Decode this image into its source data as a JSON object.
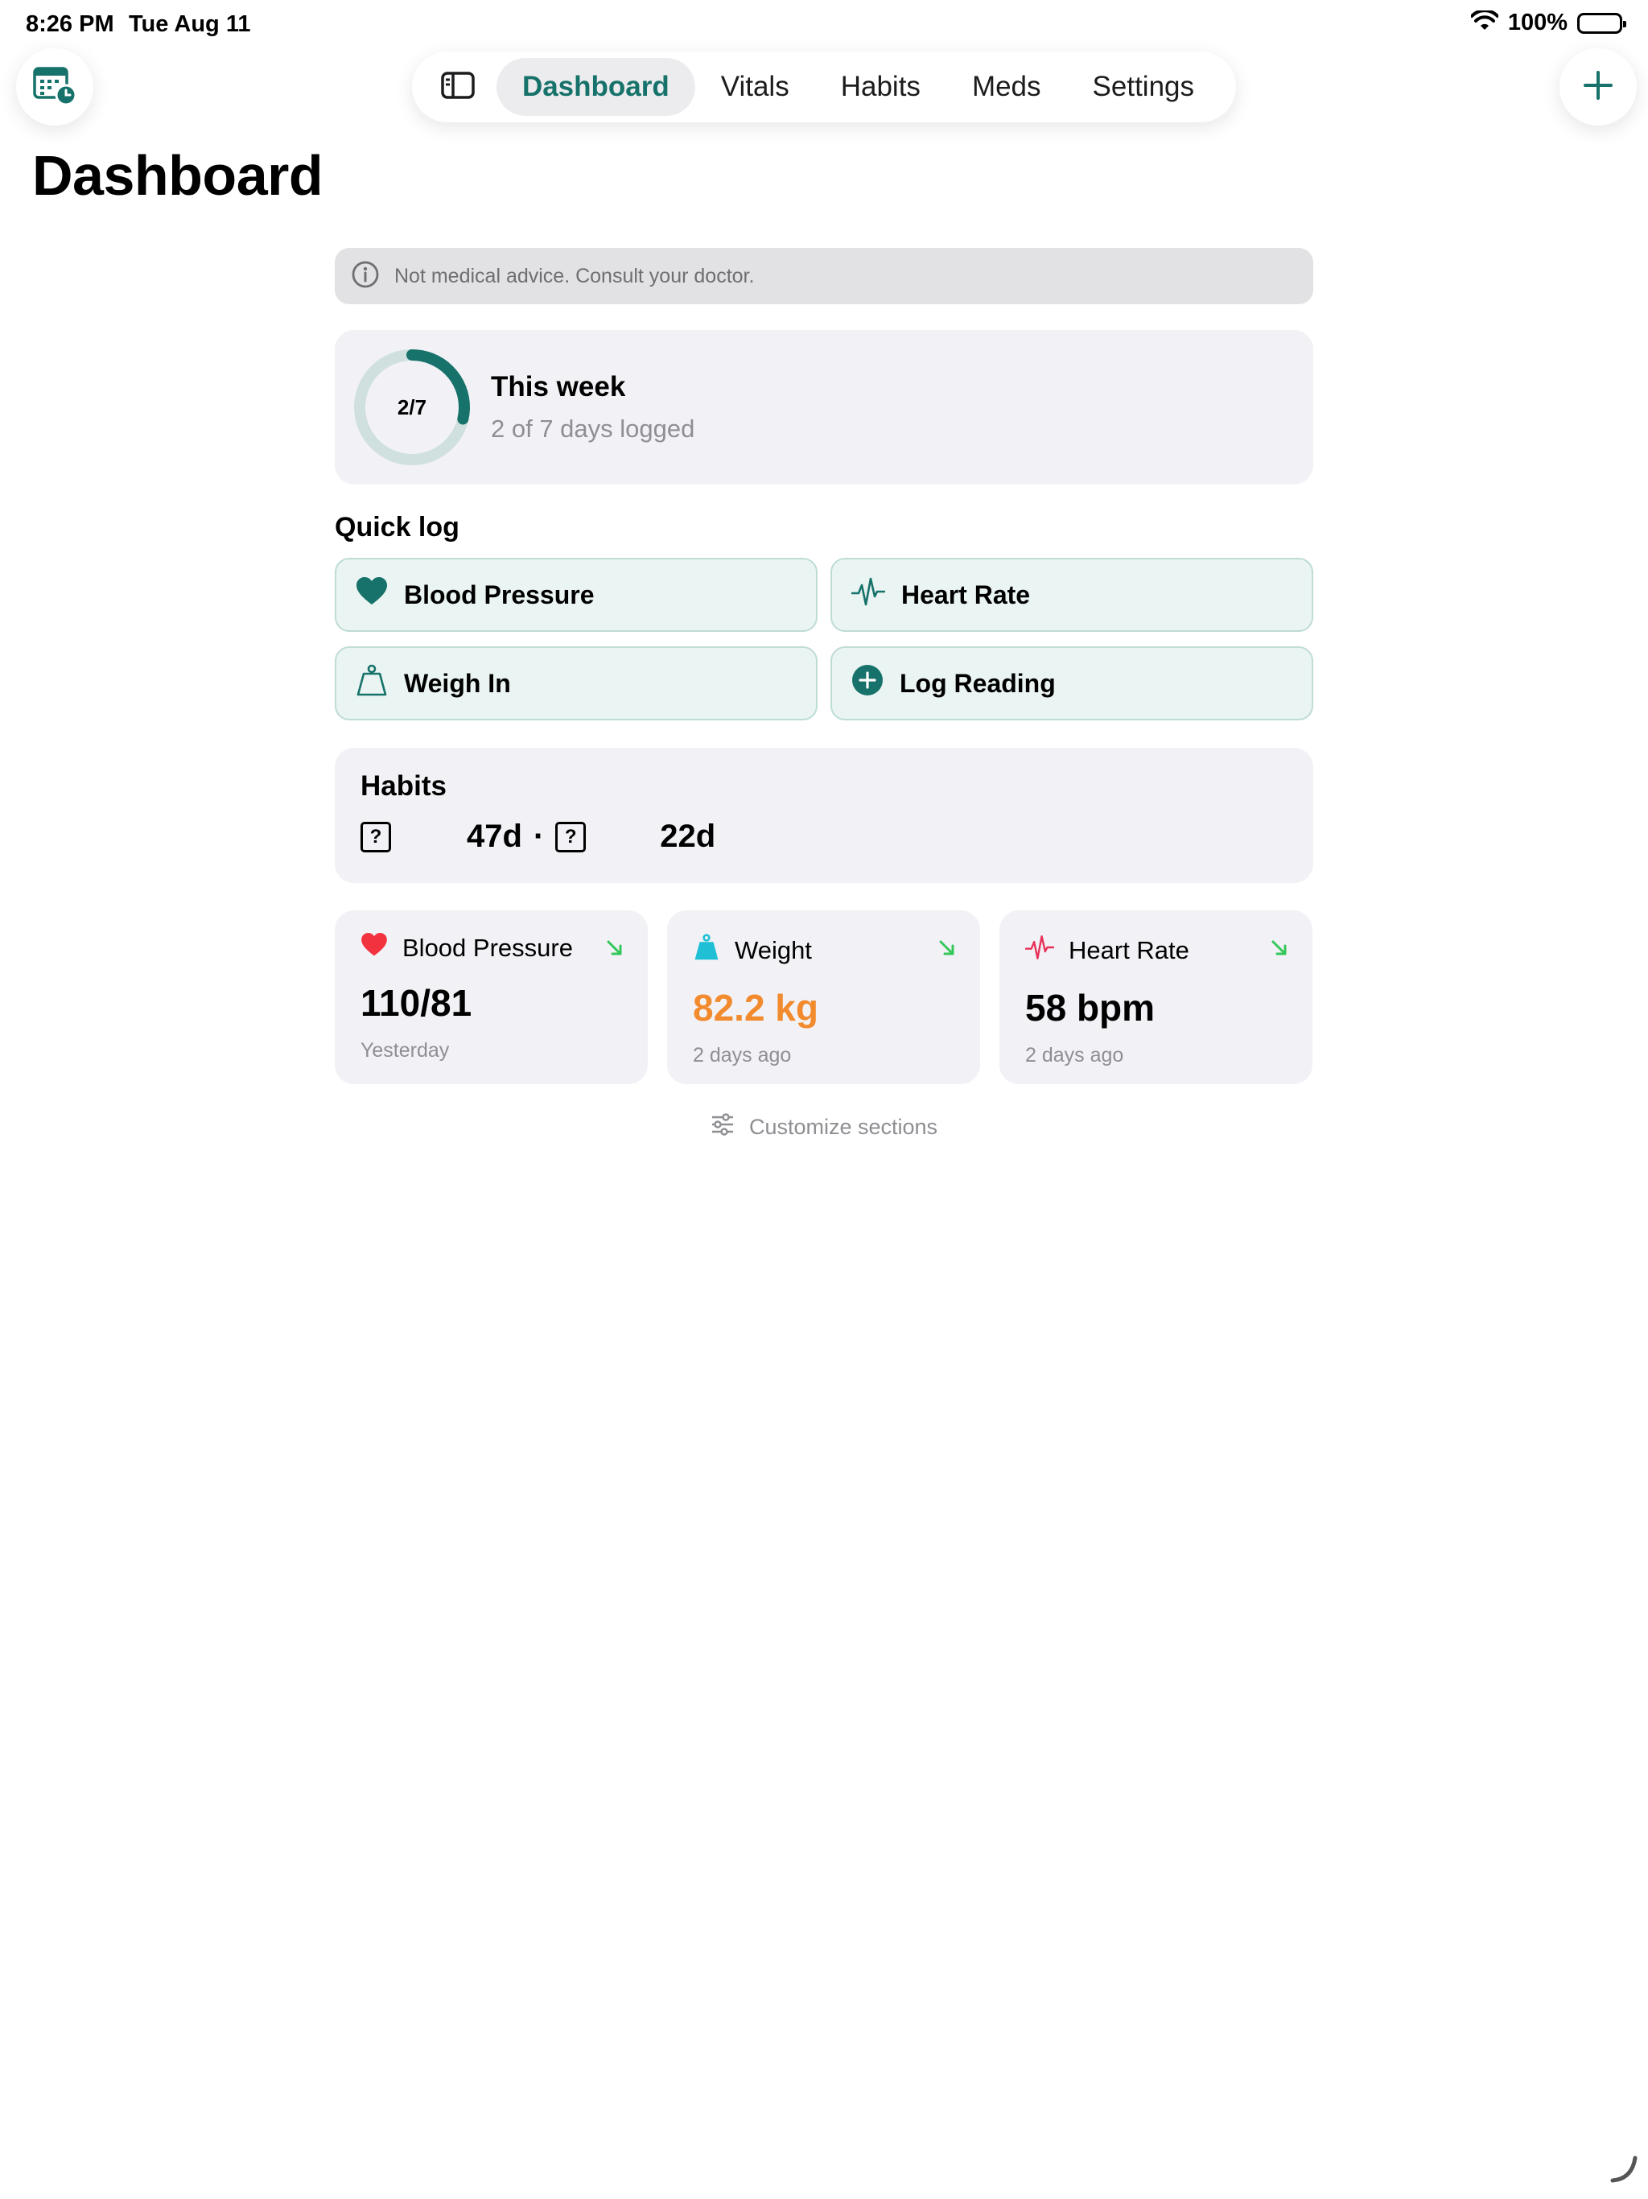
{
  "status_bar": {
    "time": "8:26 PM",
    "date": "Tue Aug 11",
    "battery": "100%"
  },
  "nav": {
    "tabs": [
      {
        "label": "Dashboard",
        "active": true
      },
      {
        "label": "Vitals"
      },
      {
        "label": "Habits"
      },
      {
        "label": "Meds"
      },
      {
        "label": "Settings"
      }
    ]
  },
  "page": {
    "title": "Dashboard"
  },
  "disclaimer": "Not medical advice. Consult your doctor.",
  "week": {
    "ring_label": "2/7",
    "logged": 2,
    "total": 7,
    "title": "This week",
    "subtitle": "2 of 7 days logged"
  },
  "quick_log": {
    "label": "Quick log",
    "items": [
      {
        "label": "Blood Pressure",
        "icon": "heart-icon"
      },
      {
        "label": "Heart Rate",
        "icon": "pulse-icon"
      },
      {
        "label": "Weigh In",
        "icon": "scale-icon"
      },
      {
        "label": "Log Reading",
        "icon": "plus-circle-icon"
      }
    ]
  },
  "habits": {
    "title": "Habits",
    "streak_1": "47d",
    "separator": "·",
    "streak_2": "22d"
  },
  "metrics": [
    {
      "label": "Blood Pressure",
      "value": "110/81",
      "time": "Yesterday",
      "trend": "down"
    },
    {
      "label": "Weight",
      "value": "82.2 kg",
      "time": "2 days ago",
      "trend": "down"
    },
    {
      "label": "Heart Rate",
      "value": "58 bpm",
      "time": "2 days ago",
      "trend": "down"
    }
  ],
  "customize": "Customize sections",
  "colors": {
    "accent": "#16726a",
    "heart_red": "#f2333f",
    "weight_teal": "#1fc0d6",
    "weight_value": "#f28a2e",
    "pulse_pink": "#e8325a",
    "trend_green": "#34c759"
  }
}
